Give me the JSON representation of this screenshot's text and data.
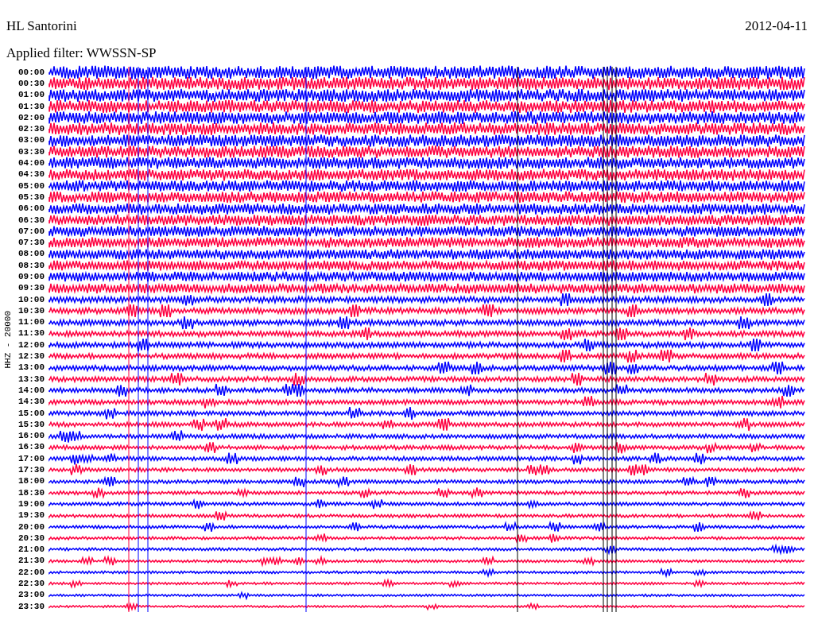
{
  "header": {
    "station": "HL Santorini",
    "date": "2012-04-11",
    "filter": "Applied filter: WWSSN-SP"
  },
  "axis_label": "HHZ - 20000",
  "rows": [
    {
      "time": "00:00",
      "color": "#0000ff"
    },
    {
      "time": "00:30",
      "color": "#ff0040"
    },
    {
      "time": "01:00",
      "color": "#0000ff"
    },
    {
      "time": "01:30",
      "color": "#ff0040"
    },
    {
      "time": "02:00",
      "color": "#0000ff"
    },
    {
      "time": "02:30",
      "color": "#ff0040"
    },
    {
      "time": "03:00",
      "color": "#0000ff"
    },
    {
      "time": "03:30",
      "color": "#ff0040"
    },
    {
      "time": "04:00",
      "color": "#0000ff"
    },
    {
      "time": "04:30",
      "color": "#ff0040"
    },
    {
      "time": "05:00",
      "color": "#0000ff"
    },
    {
      "time": "05:30",
      "color": "#ff0040"
    },
    {
      "time": "06:00",
      "color": "#0000ff"
    },
    {
      "time": "06:30",
      "color": "#ff0040"
    },
    {
      "time": "07:00",
      "color": "#0000ff"
    },
    {
      "time": "07:30",
      "color": "#ff0040"
    },
    {
      "time": "08:00",
      "color": "#0000ff"
    },
    {
      "time": "08:30",
      "color": "#ff0040"
    },
    {
      "time": "09:00",
      "color": "#0000ff"
    },
    {
      "time": "09:30",
      "color": "#ff0040"
    },
    {
      "time": "10:00",
      "color": "#0000ff"
    },
    {
      "time": "10:30",
      "color": "#ff0040"
    },
    {
      "time": "11:00",
      "color": "#0000ff"
    },
    {
      "time": "11:30",
      "color": "#ff0040"
    },
    {
      "time": "12:00",
      "color": "#0000ff"
    },
    {
      "time": "12:30",
      "color": "#ff0040"
    },
    {
      "time": "13:00",
      "color": "#0000ff"
    },
    {
      "time": "13:30",
      "color": "#ff0040"
    },
    {
      "time": "14:00",
      "color": "#0000ff"
    },
    {
      "time": "14:30",
      "color": "#ff0040"
    },
    {
      "time": "15:00",
      "color": "#0000ff"
    },
    {
      "time": "15:30",
      "color": "#ff0040"
    },
    {
      "time": "16:00",
      "color": "#0000ff"
    },
    {
      "time": "16:30",
      "color": "#ff0040"
    },
    {
      "time": "17:00",
      "color": "#0000ff"
    },
    {
      "time": "17:30",
      "color": "#ff0040"
    },
    {
      "time": "18:00",
      "color": "#0000ff"
    },
    {
      "time": "18:30",
      "color": "#ff0040"
    },
    {
      "time": "19:00",
      "color": "#0000ff"
    },
    {
      "time": "19:30",
      "color": "#ff0040"
    },
    {
      "time": "20:00",
      "color": "#0000ff"
    },
    {
      "time": "20:30",
      "color": "#ff0040"
    },
    {
      "time": "21:00",
      "color": "#0000ff"
    },
    {
      "time": "21:30",
      "color": "#ff0040"
    },
    {
      "time": "22:00",
      "color": "#0000ff"
    },
    {
      "time": "22:30",
      "color": "#ff0040"
    },
    {
      "time": "23:00",
      "color": "#0000ff"
    },
    {
      "time": "23:30",
      "color": "#ff0040"
    }
  ]
}
